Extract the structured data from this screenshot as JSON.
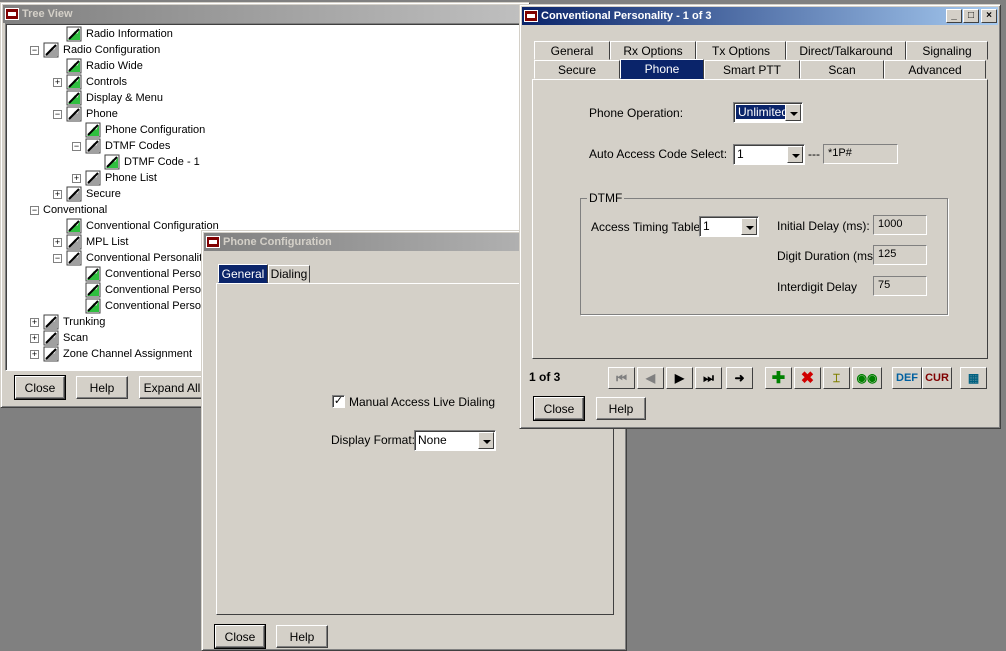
{
  "tree_view": {
    "title": "Tree View",
    "nodes": [
      {
        "label": "Radio Information",
        "level": 1,
        "expander": "",
        "icon": "green"
      },
      {
        "label": "Radio Configuration",
        "level": 0,
        "expander": "−",
        "icon": "gray"
      },
      {
        "label": "Radio Wide",
        "level": 1,
        "expander": "",
        "icon": "green"
      },
      {
        "label": "Controls",
        "level": 1,
        "expander": "+",
        "icon": "green"
      },
      {
        "label": "Display & Menu",
        "level": 1,
        "expander": "",
        "icon": "green"
      },
      {
        "label": "Phone",
        "level": 1,
        "expander": "−",
        "icon": "gray"
      },
      {
        "label": "Phone Configuration",
        "level": 2,
        "expander": "",
        "icon": "green"
      },
      {
        "label": "DTMF Codes",
        "level": 2,
        "expander": "−",
        "icon": "gray"
      },
      {
        "label": "DTMF Code - 1",
        "level": 3,
        "expander": "",
        "icon": "green"
      },
      {
        "label": "Phone List",
        "level": 2,
        "expander": "+",
        "icon": "gray"
      },
      {
        "label": "Secure",
        "level": 1,
        "expander": "+",
        "icon": "gray"
      },
      {
        "label": "Conventional",
        "level": 0,
        "expander": "−",
        "icon": "none"
      },
      {
        "label": "Conventional Configuration",
        "level": 1,
        "expander": "",
        "icon": "green"
      },
      {
        "label": "MPL List",
        "level": 1,
        "expander": "+",
        "icon": "gray"
      },
      {
        "label": "Conventional Personality",
        "level": 1,
        "expander": "−",
        "icon": "gray"
      },
      {
        "label": "Conventional Person",
        "level": 2,
        "expander": "",
        "icon": "green"
      },
      {
        "label": "Conventional Person",
        "level": 2,
        "expander": "",
        "icon": "green"
      },
      {
        "label": "Conventional Person",
        "level": 2,
        "expander": "",
        "icon": "green"
      },
      {
        "label": "Trunking",
        "level": 0,
        "expander": "+",
        "icon": "gray"
      },
      {
        "label": "Scan",
        "level": 0,
        "expander": "+",
        "icon": "gray"
      },
      {
        "label": "Zone Channel Assignment",
        "level": 0,
        "expander": "+",
        "icon": "gray"
      }
    ],
    "buttons": {
      "close": "Close",
      "help": "Help",
      "expand_all": "Expand All"
    }
  },
  "phone_config": {
    "title": "Phone Configuration",
    "tabs": [
      "General",
      "Dialing"
    ],
    "active_tab": "General",
    "checkbox_label": "Manual Access Live Dialing",
    "checkbox_checked": true,
    "checkbox_mark": "✓",
    "display_format_label": "Display Format:",
    "display_format_value": "None",
    "buttons": {
      "close": "Close",
      "help": "Help"
    }
  },
  "conv_personality": {
    "title": "Conventional Personality - 1 of 3",
    "tabs_row1": [
      "General",
      "Rx Options",
      "Tx Options",
      "Direct/Talkaround",
      "Signaling"
    ],
    "tabs_row2": [
      "Secure",
      "Phone",
      "Smart PTT",
      "Scan",
      "Advanced"
    ],
    "active_tab": "Phone",
    "phone_operation_label": "Phone Operation:",
    "phone_operation_value": "Unlimited",
    "auto_access_label": "Auto Access Code Select:",
    "auto_access_value": "1",
    "auto_access_separator": "---",
    "auto_access_code": "*1P#",
    "dtmf_group": "DTMF",
    "access_timing_label": "Access Timing Table:",
    "access_timing_value": "1",
    "initial_delay_label": "Initial Delay (ms):",
    "initial_delay_value": "1000",
    "digit_duration_label": "Digit Duration (ms):",
    "digit_duration_value": "125",
    "interdigit_label": "Interdigit Delay",
    "interdigit_value": "75",
    "record_position": "1 of 3",
    "toolbar": {
      "def_label": "DEF",
      "cur_label": "CUR"
    },
    "buttons": {
      "close": "Close",
      "help": "Help"
    },
    "caption_buttons": {
      "minimize": "_",
      "maximize": "□",
      "close": "×"
    }
  }
}
